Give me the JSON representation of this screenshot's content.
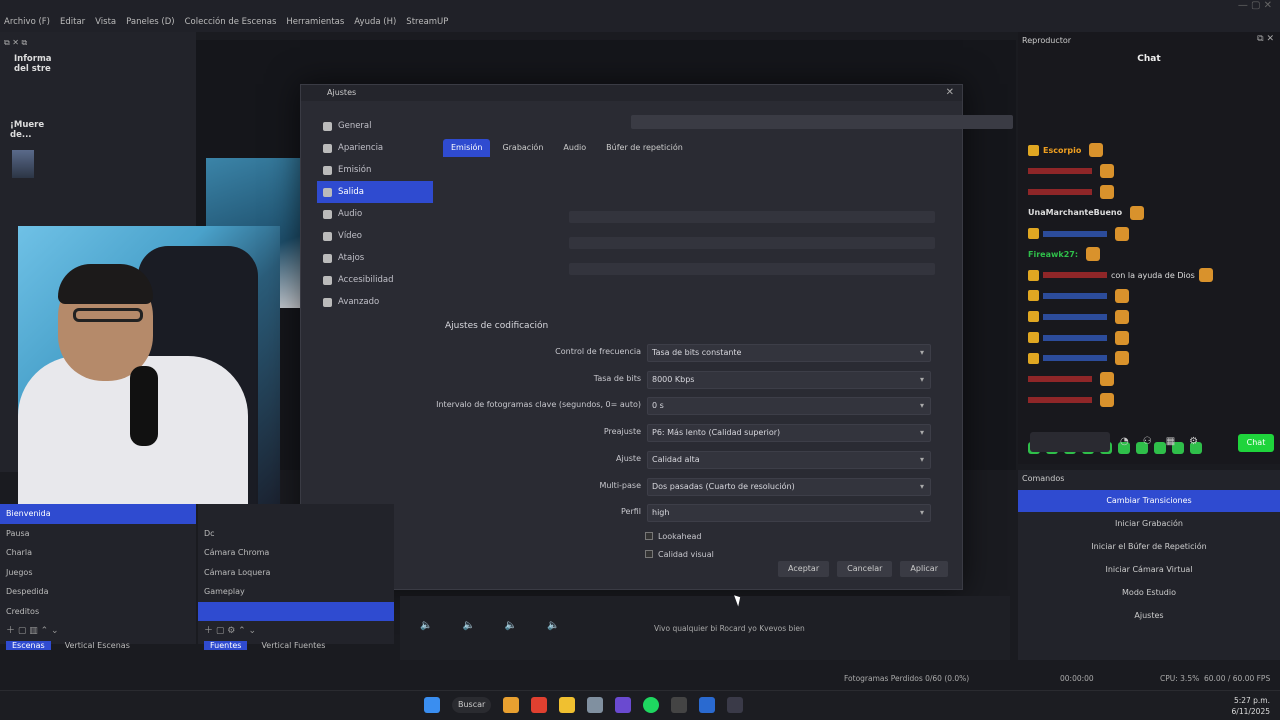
{
  "menubar": {
    "items": [
      "Archivo (F)",
      "Editar",
      "Vista",
      "Paneles (D)",
      "Colección de Escenas",
      "Herramientas",
      "Ayuda (H)",
      "StreamUP"
    ]
  },
  "left_panel": {
    "info_title": "Informa del stre",
    "label2": "¡Muere de..."
  },
  "settings": {
    "title": "Ajustes",
    "nav": [
      {
        "label": "General",
        "icon": "gear-icon"
      },
      {
        "label": "Apariencia",
        "icon": "palette-icon"
      },
      {
        "label": "Emisión",
        "icon": "antenna-icon"
      },
      {
        "label": "Salida",
        "icon": "output-icon",
        "active": true
      },
      {
        "label": "Audio",
        "icon": "speaker-icon"
      },
      {
        "label": "Vídeo",
        "icon": "monitor-icon"
      },
      {
        "label": "Atajos",
        "icon": "keyboard-icon"
      },
      {
        "label": "Accesibilidad",
        "icon": "accessibility-icon"
      },
      {
        "label": "Avanzado",
        "icon": "wrench-icon"
      }
    ],
    "tabs": [
      "Emisión",
      "Grabación",
      "Audio",
      "Búfer de repetición"
    ],
    "section_title": "Ajustes de codificación",
    "form": [
      {
        "label": "Control de frecuencia",
        "value": "Tasa de bits constante"
      },
      {
        "label": "Tasa de bits",
        "value": "8000 Kbps"
      },
      {
        "label": "Intervalo de fotogramas clave (segundos, 0= auto)",
        "value": "0 s"
      },
      {
        "label": "Preajuste",
        "value": "P6: Más lento (Calidad superior)"
      },
      {
        "label": "Ajuste",
        "value": "Calidad alta"
      },
      {
        "label": "Multi-pase",
        "value": "Dos pasadas (Cuarto de resolución)"
      },
      {
        "label": "Perfil",
        "value": "high"
      }
    ],
    "checks": [
      "Lookahead",
      "Calidad visual"
    ],
    "buttons": [
      "Aceptar",
      "Cancelar",
      "Aplicar"
    ]
  },
  "chat": {
    "header": "Reproductor",
    "title": "Chat",
    "messages": [
      {
        "user": "Escorpio",
        "text": "",
        "color": "#f0a020",
        "badge": true
      },
      {
        "user": "",
        "text": "",
        "color": "#e03030",
        "badge": false
      },
      {
        "user": "",
        "text": "",
        "color": "#e03030",
        "badge": false
      },
      {
        "user": "UnaMarchanteBueno",
        "text": "",
        "color": "#dddddd",
        "badge": false
      },
      {
        "user": "",
        "text": "",
        "color": "#3a6ff0",
        "badge": true
      },
      {
        "user": "Fireawk27:",
        "text": "",
        "color": "#2fbf4a",
        "badge": false
      },
      {
        "user": "",
        "text": "con la ayuda de Dios",
        "color": "#e03030",
        "badge": true
      },
      {
        "user": "",
        "text": "",
        "color": "#3a6ff0",
        "badge": true
      },
      {
        "user": "",
        "text": "",
        "color": "#3a6ff0",
        "badge": true
      },
      {
        "user": "",
        "text": "",
        "color": "#3a6ff0",
        "badge": true
      },
      {
        "user": "",
        "text": "",
        "color": "#3a6ff0",
        "badge": true
      },
      {
        "user": "",
        "text": "",
        "color": "#e03030",
        "badge": false
      },
      {
        "user": "",
        "text": "",
        "color": "#e03030",
        "badge": false
      }
    ],
    "send_label": "Chat"
  },
  "scenes": {
    "items": [
      "Bienvenida",
      "Pausa",
      "Charla",
      "Juegos",
      "Despedida",
      "Creditos"
    ],
    "selected": 0,
    "tabs": [
      "Escenas",
      "Vertical Escenas"
    ]
  },
  "sources": {
    "items": [
      "",
      "Dc",
      "Cámara Chroma",
      "Cámara Loquera",
      "Gameplay",
      ""
    ],
    "selected": 5,
    "tabs": [
      "Fuentes",
      "Vertical Fuentes"
    ]
  },
  "transitions": {
    "header": "Comandos",
    "items": [
      "Cambiar Transiciones",
      "Iniciar Grabación",
      "Iniciar el Búfer de Repetición",
      "Iniciar Cámara Virtual",
      "Modo Estudio",
      "Ajustes"
    ],
    "selected": 0
  },
  "mixer": {
    "now_playing": "Vivo qualquier bi Rocard yo Kvevos bien"
  },
  "statusbar": {
    "left": "Fotogramas Perdidos 0/60 (0.0%)",
    "mid": "00:00:00",
    "cpu": "CPU: 3.5%",
    "fps": "60.00 / 60.00 FPS"
  },
  "taskbar": {
    "search": "Buscar",
    "time": "5:27 p.m.",
    "date": "6/11/2025"
  }
}
